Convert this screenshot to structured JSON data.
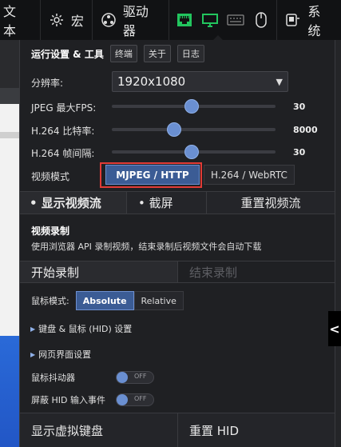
{
  "topbar": {
    "text_label": "文本",
    "macro_label": "宏",
    "drive_label": "驱动器",
    "system_label": "系统",
    "icons": [
      "gear-icon",
      "drive-icon",
      "ethernet-icon",
      "monitor-icon",
      "keyboard-icon",
      "mouse-icon"
    ]
  },
  "panel": {
    "section_title": "运行设置 & 工具",
    "chips": [
      "终端",
      "关于",
      "日志"
    ],
    "resolution_label": "分辨率:",
    "resolution_value": "1920x1080",
    "sliders": [
      {
        "label": "JPEG 最大FPS:",
        "value": "30",
        "level": 0.49
      },
      {
        "label": "H.264 比特率:",
        "value": "8000",
        "level": 0.38
      },
      {
        "label": "H.264 帧间隔:",
        "value": "30",
        "level": 0.49
      }
    ],
    "video_mode_label": "视频模式",
    "video_mode_active": "MJPEG / HTTP",
    "video_mode_other": "H.264 / WebRTC",
    "stream_tabs": [
      "• 显示视频流",
      "• 截屏",
      "重置视频流"
    ],
    "recording_title": "视频录制",
    "recording_desc": "使用浏览器 API 录制视频，结束录制后视频文件会自动下载",
    "start_record": "开始录制",
    "stop_record": "结束录制",
    "mouse_mode_label": "鼠标模式:",
    "mouse_mode_absolute": "Absolute",
    "mouse_mode_relative": "Relative",
    "hid_settings": "键盘 & 鼠标 (HID) 设置",
    "web_settings": "网页界面设置",
    "jiggler_label": "鼠标抖动器",
    "jiggler_state": "OFF",
    "block_hid_label": "屏蔽 HID 输入事件",
    "block_hid_state": "OFF",
    "show_keyboard": "显示虚拟键盘",
    "reset_hid": "重置 HID"
  },
  "side_handle": "<",
  "colors": {
    "accent": "#3b5c95",
    "highlight_border": "#e23b36"
  }
}
